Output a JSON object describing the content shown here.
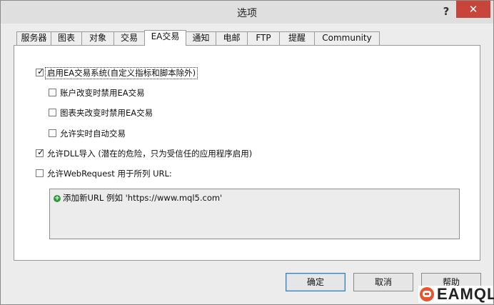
{
  "window": {
    "title": "选项",
    "help_glyph": "?",
    "close_glyph": "✕"
  },
  "tabs": [
    {
      "label": "服务器"
    },
    {
      "label": "图表"
    },
    {
      "label": "对象"
    },
    {
      "label": "交易"
    },
    {
      "label": "EA交易",
      "active": true
    },
    {
      "label": "通知"
    },
    {
      "label": "电邮"
    },
    {
      "label": "FTP"
    },
    {
      "label": "提醒"
    },
    {
      "label": "Community"
    }
  ],
  "options": {
    "enable_ea": {
      "label": "启用EA交易系统(自定义指标和脚本除外)",
      "checked": true
    },
    "disable_on_account_change": {
      "label": "账户改变时禁用EA交易",
      "checked": false
    },
    "disable_on_profile_change": {
      "label": "图表夹改变时禁用EA交易",
      "checked": false
    },
    "allow_live_trading": {
      "label": "允许实时自动交易",
      "checked": false
    },
    "allow_dll": {
      "label": "允许DLL导入 (潜在的危险，只为受信任的应用程序启用)",
      "checked": true
    },
    "allow_webrequest": {
      "label": "允许WebRequest 用于所列 URL:",
      "checked": false
    }
  },
  "url_list": {
    "add_label": "添加新URL 例如 'https://www.mql5.com'",
    "icon": "plus-circle-icon"
  },
  "buttons": {
    "ok": "确定",
    "cancel": "取消",
    "help": "帮助"
  },
  "watermark": {
    "text": "EAMQL"
  },
  "colors": {
    "accent_close": "#c7453b",
    "add_icon": "#2f9a3a",
    "logo": "#e8542e"
  }
}
